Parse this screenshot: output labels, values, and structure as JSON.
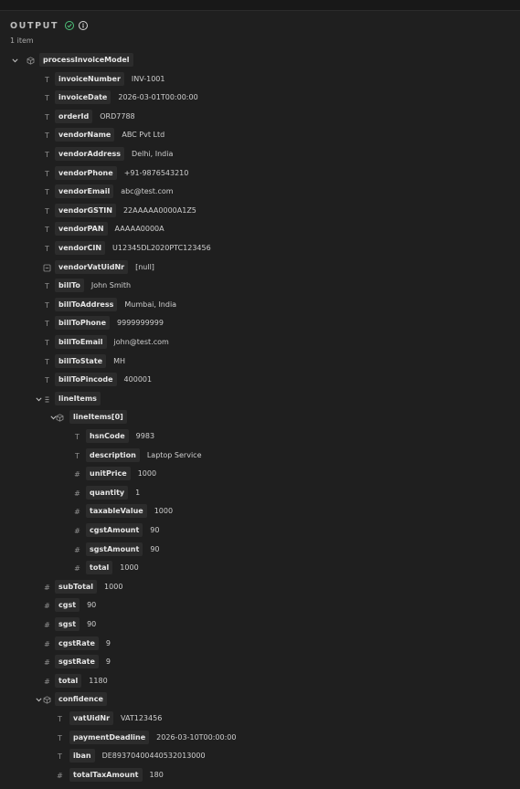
{
  "header": {
    "title": "OUTPUT",
    "count": "1 item"
  },
  "rows": [
    {
      "level": 0,
      "type": "object",
      "key": "processInvoiceModel",
      "value": "",
      "expanded": true
    },
    {
      "level": 1,
      "type": "string",
      "key": "invoiceNumber",
      "value": "INV-1001"
    },
    {
      "level": 1,
      "type": "string",
      "key": "invoiceDate",
      "value": "2026-03-01T00:00:00"
    },
    {
      "level": 1,
      "type": "string",
      "key": "orderId",
      "value": "ORD7788"
    },
    {
      "level": 1,
      "type": "string",
      "key": "vendorName",
      "value": "ABC Pvt Ltd"
    },
    {
      "level": 1,
      "type": "string",
      "key": "vendorAddress",
      "value": "Delhi, India"
    },
    {
      "level": 1,
      "type": "string",
      "key": "vendorPhone",
      "value": "+91-9876543210"
    },
    {
      "level": 1,
      "type": "string",
      "key": "vendorEmail",
      "value": "abc@test.com"
    },
    {
      "level": 1,
      "type": "string",
      "key": "vendorGSTIN",
      "value": "22AAAAA0000A1Z5"
    },
    {
      "level": 1,
      "type": "string",
      "key": "vendorPAN",
      "value": "AAAAA0000A"
    },
    {
      "level": 1,
      "type": "string",
      "key": "vendorCIN",
      "value": "U12345DL2020PTC123456"
    },
    {
      "level": 1,
      "type": "null",
      "key": "vendorVatUidNr",
      "value": "[null]"
    },
    {
      "level": 1,
      "type": "string",
      "key": "billTo",
      "value": "John Smith"
    },
    {
      "level": 1,
      "type": "string",
      "key": "billToAddress",
      "value": "Mumbai, India"
    },
    {
      "level": 1,
      "type": "string",
      "key": "billToPhone",
      "value": "9999999999"
    },
    {
      "level": 1,
      "type": "string",
      "key": "billToEmail",
      "value": "john@test.com"
    },
    {
      "level": 1,
      "type": "string",
      "key": "billToState",
      "value": "MH"
    },
    {
      "level": 1,
      "type": "string",
      "key": "billToPincode",
      "value": "400001"
    },
    {
      "level": 1,
      "type": "array",
      "key": "lineItems",
      "value": "",
      "expanded": true
    },
    {
      "level": 2,
      "type": "object",
      "key": "lineItems[0]",
      "value": "",
      "expanded": true
    },
    {
      "level": 3,
      "type": "string",
      "key": "hsnCode",
      "value": "9983"
    },
    {
      "level": 3,
      "type": "string",
      "key": "description",
      "value": "Laptop Service"
    },
    {
      "level": 3,
      "type": "number",
      "key": "unitPrice",
      "value": "1000"
    },
    {
      "level": 3,
      "type": "number",
      "key": "quantity",
      "value": "1"
    },
    {
      "level": 3,
      "type": "number",
      "key": "taxableValue",
      "value": "1000"
    },
    {
      "level": 3,
      "type": "number",
      "key": "cgstAmount",
      "value": "90"
    },
    {
      "level": 3,
      "type": "number",
      "key": "sgstAmount",
      "value": "90"
    },
    {
      "level": 3,
      "type": "number",
      "key": "total",
      "value": "1000"
    },
    {
      "level": 1,
      "type": "number",
      "key": "subTotal",
      "value": "1000"
    },
    {
      "level": 1,
      "type": "number",
      "key": "cgst",
      "value": "90"
    },
    {
      "level": 1,
      "type": "number",
      "key": "sgst",
      "value": "90"
    },
    {
      "level": 1,
      "type": "number",
      "key": "cgstRate",
      "value": "9"
    },
    {
      "level": 1,
      "type": "number",
      "key": "sgstRate",
      "value": "9"
    },
    {
      "level": 1,
      "type": "number",
      "key": "total",
      "value": "1180"
    },
    {
      "level": 1,
      "type": "object",
      "key": "confidence",
      "value": "",
      "expanded": true
    },
    {
      "level": 2,
      "type": "string",
      "key": "vatUidNr",
      "value": "VAT123456"
    },
    {
      "level": 2,
      "type": "string",
      "key": "paymentDeadline",
      "value": "2026-03-10T00:00:00"
    },
    {
      "level": 2,
      "type": "string",
      "key": "iban",
      "value": "DE89370400440532013000"
    },
    {
      "level": 2,
      "type": "number",
      "key": "totalTaxAmount",
      "value": "180"
    }
  ],
  "icons": {
    "status": "check-circle-icon",
    "info": "info-icon",
    "string": "text-type-icon",
    "number": "hash-icon",
    "null": "null-icon",
    "object": "object-icon",
    "array": "array-icon",
    "chevron": "chevron-down-icon"
  },
  "colors": {
    "background": "#1f1f1f",
    "key_background": "#2c2c2c",
    "success": "#4ec27a"
  }
}
